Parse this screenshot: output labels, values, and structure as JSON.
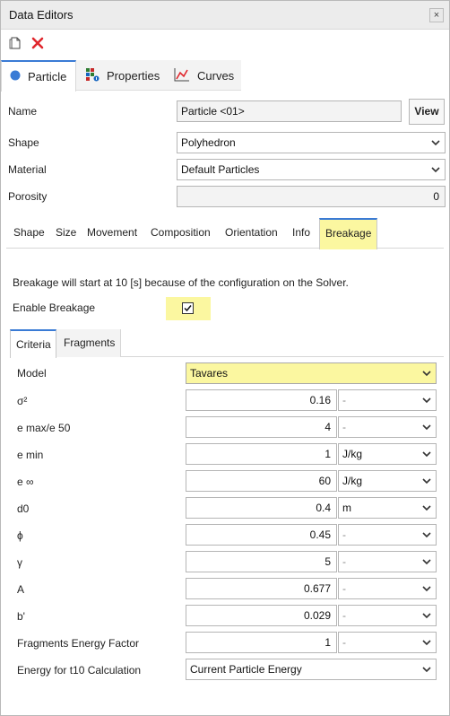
{
  "window": {
    "title": "Data Editors",
    "close_glyph": "×"
  },
  "toolbar": {
    "new_icon": "document-icon",
    "delete_icon": "delete-x-icon"
  },
  "outer_tabs": [
    {
      "label": "Particle",
      "icon": "circle-icon"
    },
    {
      "label": "Properties",
      "icon": "properties-icon"
    },
    {
      "label": "Curves",
      "icon": "curves-icon"
    }
  ],
  "form": {
    "name_label": "Name",
    "name_value": "Particle <01>",
    "view_label": "View",
    "shape_label": "Shape",
    "shape_value": "Polyhedron",
    "material_label": "Material",
    "material_value": "Default Particles",
    "porosity_label": "Porosity",
    "porosity_value": "0"
  },
  "inner_tabs": [
    "Shape",
    "Size",
    "Movement",
    "Composition",
    "Orientation",
    "Info",
    "Breakage"
  ],
  "breakage": {
    "info": "Breakage will start at 10 [s] because of the configuration on the Solver.",
    "enable_label": "Enable Breakage",
    "enabled": true,
    "check_glyph": "✓"
  },
  "criteria_tabs": [
    "Criteria",
    "Fragments"
  ],
  "model": {
    "label": "Model",
    "value": "Tavares"
  },
  "params": [
    {
      "label": "σ²",
      "value": "0.16",
      "unit": "-"
    },
    {
      "label": "e max/e 50",
      "value": "4",
      "unit": "-"
    },
    {
      "label": "e min",
      "value": "1",
      "unit": "J/kg"
    },
    {
      "label": "e ∞",
      "value": "60",
      "unit": "J/kg"
    },
    {
      "label": "d0",
      "value": "0.4",
      "unit": "m"
    },
    {
      "label": "ϕ",
      "value": "0.45",
      "unit": "-"
    },
    {
      "label": "γ",
      "value": "5",
      "unit": "-"
    },
    {
      "label": "A",
      "value": "0.677",
      "unit": "-"
    },
    {
      "label": "b'",
      "value": "0.029",
      "unit": "-"
    },
    {
      "label": "Fragments Energy Factor",
      "value": "1",
      "unit": "-"
    }
  ],
  "energy": {
    "label": "Energy for t10 Calculation",
    "value": "Current Particle Energy"
  },
  "colors": {
    "accent": "#3a7bd5",
    "highlight": "#fbf7a0",
    "delete": "#e0262c"
  }
}
